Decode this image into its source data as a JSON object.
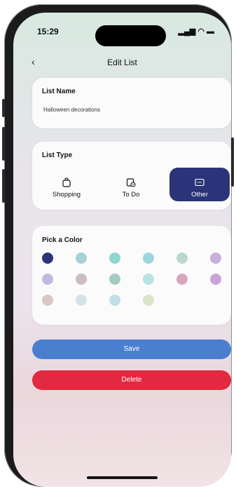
{
  "status": {
    "time": "15:29",
    "indicators": "▮▮▮ • ▬"
  },
  "header": {
    "title": "Edit List"
  },
  "list_name": {
    "label": "List Name",
    "value": "Halloween decorations"
  },
  "list_type": {
    "label": "List Type",
    "options": [
      {
        "label": "Shopping",
        "icon": "shopping-bag-icon"
      },
      {
        "label": "To Do",
        "icon": "calendar-clock-icon"
      },
      {
        "label": "Other",
        "icon": "placeholder-icon",
        "selected": true
      }
    ]
  },
  "color_picker": {
    "label": "Pick a Color",
    "colors": [
      "#2c3479",
      "#a7d0d8",
      "#8fd6cd",
      "#9bd8de",
      "#bcd8cd",
      "#c7b0dc",
      "#c3b8e0",
      "#cdbcc6",
      "#a5c9c3",
      "#b8e2e4",
      "#d7a6bd",
      "#c9a4d8",
      "#dcc5c2",
      "#d2e4ea",
      "#c2dfe8",
      "#d9e5c8"
    ],
    "selected_index": 0
  },
  "actions": {
    "save_label": "Save",
    "delete_label": "Delete"
  },
  "colors": {
    "accent": "#2c3479",
    "save": "#4a7fd0",
    "delete": "#e1293f"
  }
}
